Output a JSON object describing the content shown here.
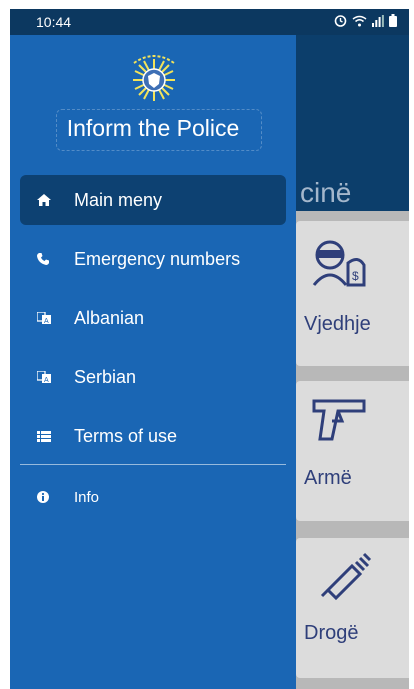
{
  "status_bar": {
    "time": "10:44",
    "icons": [
      "alarm-icon",
      "wifi-icon",
      "signal-icon",
      "battery-icon"
    ]
  },
  "background_screen": {
    "title_partial": "cinë",
    "cards": [
      {
        "label": "Vjedhje",
        "icon": "thief-icon"
      },
      {
        "label": "Armë",
        "icon": "gun-icon"
      },
      {
        "label": "Drogë",
        "icon": "syringe-icon"
      }
    ]
  },
  "drawer": {
    "app_title": "Inform the Police",
    "logo": "kosovo-police-logo",
    "menu": [
      {
        "label": "Main meny",
        "icon": "home-icon",
        "active": true
      },
      {
        "label": "Emergency numbers",
        "icon": "phone-icon",
        "active": false
      },
      {
        "label": "Albanian",
        "icon": "translate-icon",
        "active": false
      },
      {
        "label": "Serbian",
        "icon": "translate-icon",
        "active": false
      },
      {
        "label": "Terms of use",
        "icon": "list-icon",
        "active": false
      }
    ],
    "info": {
      "label": "Info",
      "icon": "info-icon"
    }
  },
  "colors": {
    "drawer_bg": "#1a66b4",
    "active_item_bg": "#0d4172",
    "header_bg": "#0c3e6b",
    "accent_text": "#2f3f7a"
  }
}
